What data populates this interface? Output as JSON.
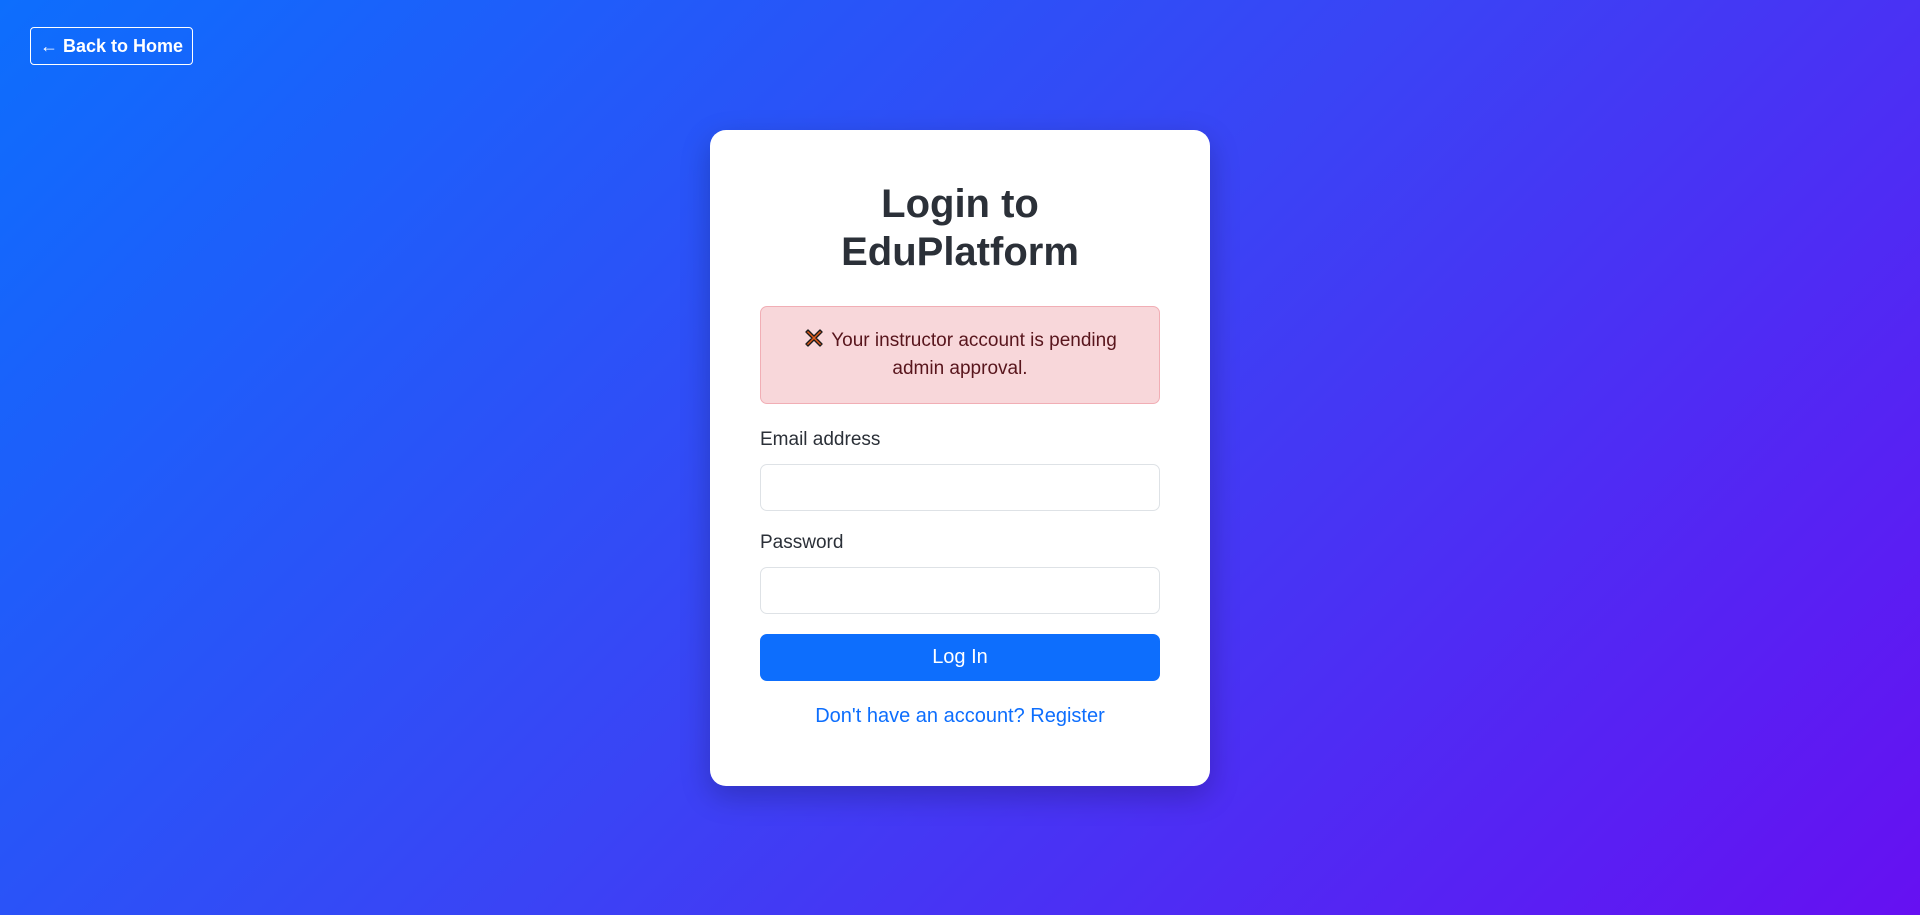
{
  "nav": {
    "back_label": "← Back to Home"
  },
  "login": {
    "title_line1": "Login to",
    "title_line2": "EduPlatform",
    "alert": {
      "icon": "close-x-icon",
      "text": "Your instructor account is pending admin approval."
    },
    "email_label": "Email address",
    "email_value": "",
    "password_label": "Password",
    "password_value": "",
    "submit_label": "Log In",
    "register_link": "Don't have an account? Register"
  },
  "colors": {
    "primary": "#0d6efd",
    "gradient_start": "#0d6efd",
    "gradient_end": "#6610f2",
    "alert_bg": "#f8d7da",
    "alert_text": "#58151c"
  }
}
